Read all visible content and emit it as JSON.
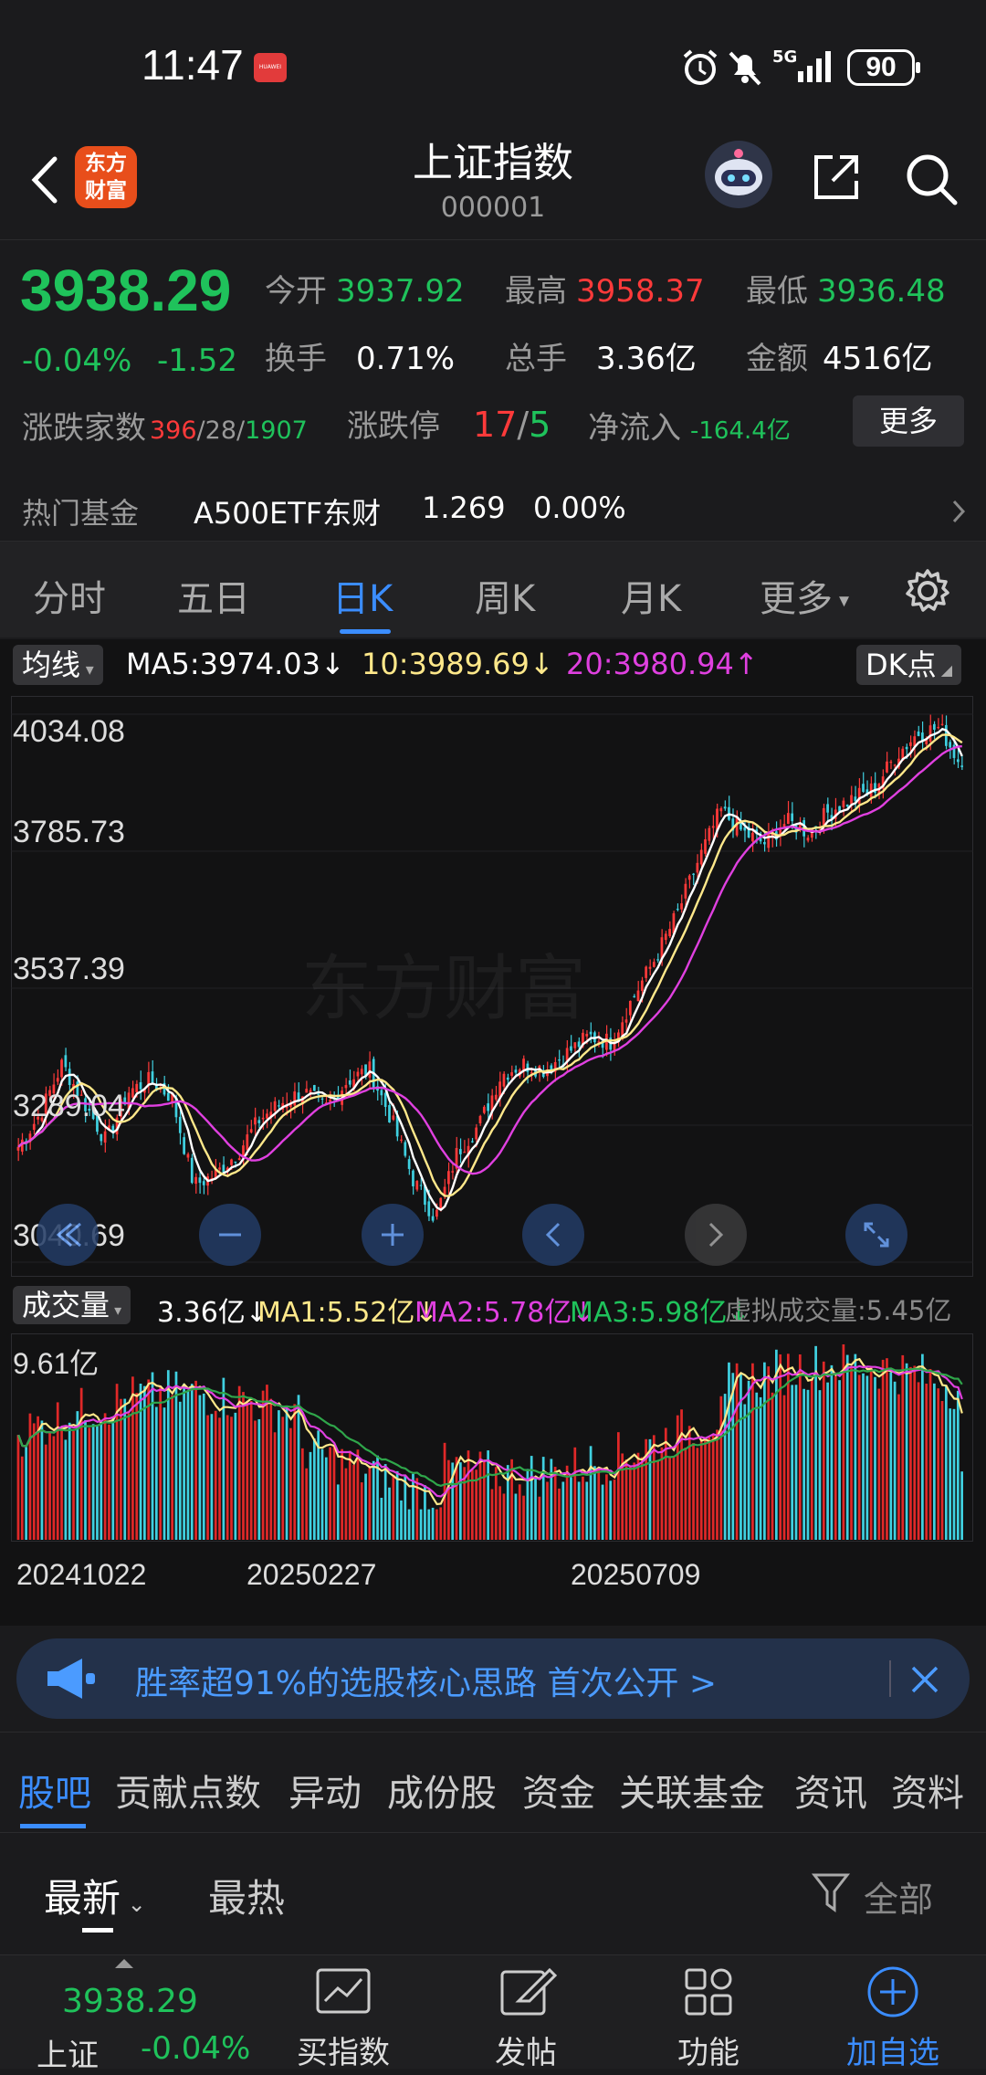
{
  "status_bar": {
    "time": "11:47",
    "network": "5G",
    "battery": "90"
  },
  "header": {
    "title": "上证指数",
    "code": "000001",
    "logo_text_1": "东方",
    "logo_text_2": "财富"
  },
  "quote": {
    "price": "3938.29",
    "change_pct": "-0.04%",
    "change": "-1.52",
    "open_label": "今开",
    "open": "3937.92",
    "high_label": "最高",
    "high": "3958.37",
    "low_label": "最低",
    "low": "3936.48",
    "turnover_label": "换手",
    "turnover": "0.71%",
    "volume_label": "总手",
    "volume": "3.36亿",
    "amount_label": "金额",
    "amount": "4516亿",
    "breadth_label": "涨跌家数",
    "breadth_up": "396",
    "breadth_flat": "28",
    "breadth_down": "1907",
    "limit_label": "涨跌停",
    "limit_up": "17",
    "limit_down": "5",
    "netflow_label": "净流入",
    "netflow": "-164.4亿",
    "more_button": "更多",
    "hot_fund_label": "热门基金",
    "hot_fund_name": "A500ETF东财",
    "hot_fund_price": "1.269",
    "hot_fund_change": "0.00%"
  },
  "period_tabs": [
    "分时",
    "五日",
    "日K",
    "周K",
    "月K",
    "更多"
  ],
  "active_period": "日K",
  "chart_legend": {
    "ma_chip": "均线",
    "ma5": "MA5:3974.03",
    "ma10": "10:3989.69",
    "ma20": "20:3980.94",
    "dk_chip": "DK点",
    "watermark": "东方财富"
  },
  "volume_legend": {
    "chip": "成交量",
    "vol": "3.36亿",
    "ma1": "MA1:5.52亿",
    "ma2": "MA2:5.78亿",
    "ma3": "MA3:5.98亿",
    "virtual": "虚拟成交量:5.45亿",
    "ymax": "9.61亿"
  },
  "colors": {
    "up": "#ff3a3a",
    "down": "#1fc25b",
    "ma5": "#ffffff",
    "ma10": "#ffe88a",
    "ma20": "#e040e0",
    "accent": "#3b8dff"
  },
  "chart_data": [
    {
      "type": "candlestick",
      "title": "",
      "y_ticks": [
        "4034.08",
        "3785.73",
        "3537.39",
        "3289.04",
        "3040.69"
      ],
      "ylim": [
        3040.69,
        4034.08
      ],
      "x_ticks": [
        "20241022",
        "20250227",
        "20250709"
      ],
      "series": [
        {
          "name": "MA5",
          "last": 3974.03
        },
        {
          "name": "MA10",
          "last": 3989.69
        },
        {
          "name": "MA20",
          "last": 3980.94
        }
      ],
      "close_path_approx": [
        3250,
        3310,
        3400,
        3330,
        3260,
        3350,
        3370,
        3340,
        3180,
        3200,
        3240,
        3300,
        3330,
        3350,
        3320,
        3370,
        3390,
        3300,
        3190,
        3120,
        3240,
        3290,
        3380,
        3400,
        3390,
        3420,
        3450,
        3440,
        3520,
        3590,
        3670,
        3770,
        3860,
        3820,
        3800,
        3840,
        3820,
        3860,
        3880,
        3900,
        3960,
        4000,
        4010,
        3938.29
      ]
    },
    {
      "type": "bar",
      "title": "",
      "ylabel": "",
      "ymax_label": "9.61亿",
      "last_value": 3.36,
      "ma_values": {
        "MA1": 5.52,
        "MA2": 5.78,
        "MA3": 5.98
      }
    }
  ],
  "banner": {
    "text": "胜率超91%的选股核心思路 首次公开 >"
  },
  "content_tabs": [
    "股吧",
    "贡献点数",
    "异动",
    "成份股",
    "资金",
    "关联基金",
    "资讯",
    "资料"
  ],
  "active_content_tab": "股吧",
  "sort": {
    "latest": "最新",
    "hottest": "最热",
    "filter": "全部"
  },
  "footer": {
    "index_price": "3938.29",
    "index_name": "上证",
    "index_change": "-0.04%",
    "items": [
      "买指数",
      "发帖",
      "功能",
      "加自选"
    ]
  }
}
